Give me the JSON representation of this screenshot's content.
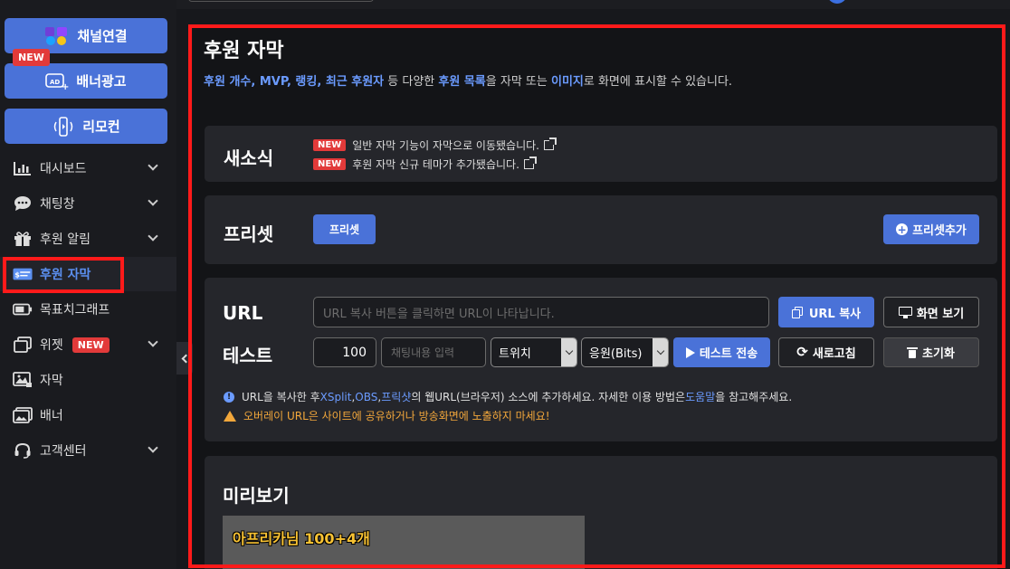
{
  "sidebar": {
    "buttons": [
      {
        "label": "채널연결",
        "icon": "channel-link-icon"
      },
      {
        "label": "배너광고",
        "icon": "ad-icon"
      },
      {
        "label": "리모컨",
        "icon": "remote-icon"
      }
    ],
    "new_badge": "NEW",
    "items": [
      {
        "label": "대시보드",
        "icon": "chart-icon",
        "expandable": true
      },
      {
        "label": "채팅창",
        "icon": "chat-icon",
        "expandable": true
      },
      {
        "label": "후원 알림",
        "icon": "gift-icon",
        "expandable": true
      },
      {
        "label": "후원 자막",
        "icon": "donation-caption-icon",
        "active": true
      },
      {
        "label": "목표치그래프",
        "icon": "battery-icon"
      },
      {
        "label": "위젯",
        "icon": "widget-icon",
        "badge": "NEW",
        "expandable": true
      },
      {
        "label": "자막",
        "icon": "image-icon"
      },
      {
        "label": "배너",
        "icon": "banner-icon"
      },
      {
        "label": "고객센터",
        "icon": "headset-icon",
        "expandable": true
      }
    ]
  },
  "page": {
    "title": "후원 자막",
    "desc": {
      "p1": "후원 개수, MVP, 랭킹, 최근 후원자",
      "p2": " 등 다양한 ",
      "p3": "후원 목록",
      "p4": "을 자막 또는 ",
      "p5": "이미지",
      "p6": "로 화면에 표시할 수 있습니다."
    }
  },
  "news": {
    "title": "새소식",
    "items": [
      {
        "badge": "NEW",
        "text": "일반 자막 기능이 자막으로 이동됐습니다."
      },
      {
        "badge": "NEW",
        "text": "후원 자막 신규 테마가 추가됐습니다."
      }
    ]
  },
  "preset": {
    "title": "프리셋",
    "chip": "프리셋",
    "add_label": "프리셋추가"
  },
  "url": {
    "label": "URL",
    "placeholder": "URL 복사 버튼을 클릭하면 URL이 나타납니다.",
    "copy_label": "URL 복사",
    "view_label": "화면 보기"
  },
  "test": {
    "label": "테스트",
    "amount": "100",
    "chat_placeholder": "채팅내용 입력",
    "platform": "트위치",
    "type": "응원(Bits)",
    "send_label": "테스트 전송",
    "refresh_label": "새로고침",
    "reset_label": "초기화"
  },
  "info": {
    "a1": "URL을 복사한 후 ",
    "a2": "XSplit",
    "a3": ", ",
    "a4": "OBS",
    "a5": ", ",
    "a6": "프릭샷",
    "a7": "의 웹URL(브라우저) 소스에 추가하세요. 자세한 이용 방법은 ",
    "a8": "도움말",
    "a9": "을 참고해주세요.",
    "warning": "오버레이 URL은 사이트에 공유하거나 방송화면에 노출하지 마세요!"
  },
  "preview": {
    "title": "미리보기",
    "text": "아프리카님 100+4개"
  },
  "colors": {
    "accent": "#4a72d8",
    "link": "#6b9bff",
    "badge_red": "#e23a3a",
    "warning": "#f2a73b",
    "highlight_outline": "#ff1a1a"
  }
}
